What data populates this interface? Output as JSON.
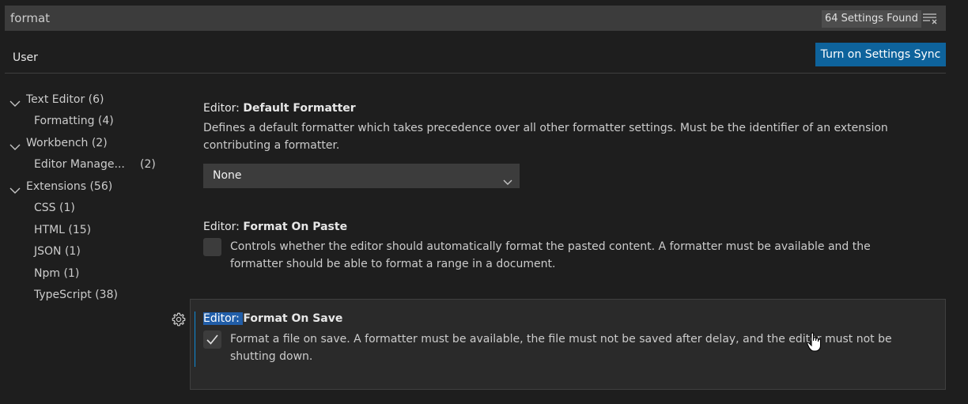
{
  "search": {
    "value": "format",
    "results_count": "64 Settings Found"
  },
  "tabs": {
    "user": "User"
  },
  "sync_button": "Turn on Settings Sync",
  "toc": [
    {
      "label": "Text Editor (6)"
    },
    {
      "label": "Formatting (4)"
    },
    {
      "label": "Workbench (2)"
    },
    {
      "label": "Editor Manage...",
      "count": "(2)"
    },
    {
      "label": "Extensions (56)"
    },
    {
      "label": "CSS (1)"
    },
    {
      "label": "HTML (15)"
    },
    {
      "label": "JSON (1)"
    },
    {
      "label": "Npm (1)"
    },
    {
      "label": "TypeScript (38)"
    }
  ],
  "settings": [
    {
      "category": "Editor: ",
      "name": "Default Formatter",
      "description": "Defines a default formatter which takes precedence over all other formatter settings. Must be the identifier of an extension contributing a formatter.",
      "value": "None"
    },
    {
      "category": "Editor: ",
      "name": "Format On Paste",
      "description": "Controls whether the editor should automatically format the pasted content. A formatter must be available and the formatter should be able to format a range in a document.",
      "checked": false
    },
    {
      "category": "Editor: ",
      "name": "Format On Save",
      "description": "Format a file on save. A formatter must be available, the file must not be saved after delay, and the editor must not be shutting down.",
      "checked": true
    }
  ],
  "icons": {
    "clear": "clear-filter-icon",
    "gear": "gear-icon",
    "check": "check-icon",
    "chevron": "chevron-down-icon",
    "cursor": "hand-cursor-icon"
  },
  "colors": {
    "accent": "#0e639c",
    "focus": "#0e8ad6",
    "highlight": "#215ea8"
  }
}
